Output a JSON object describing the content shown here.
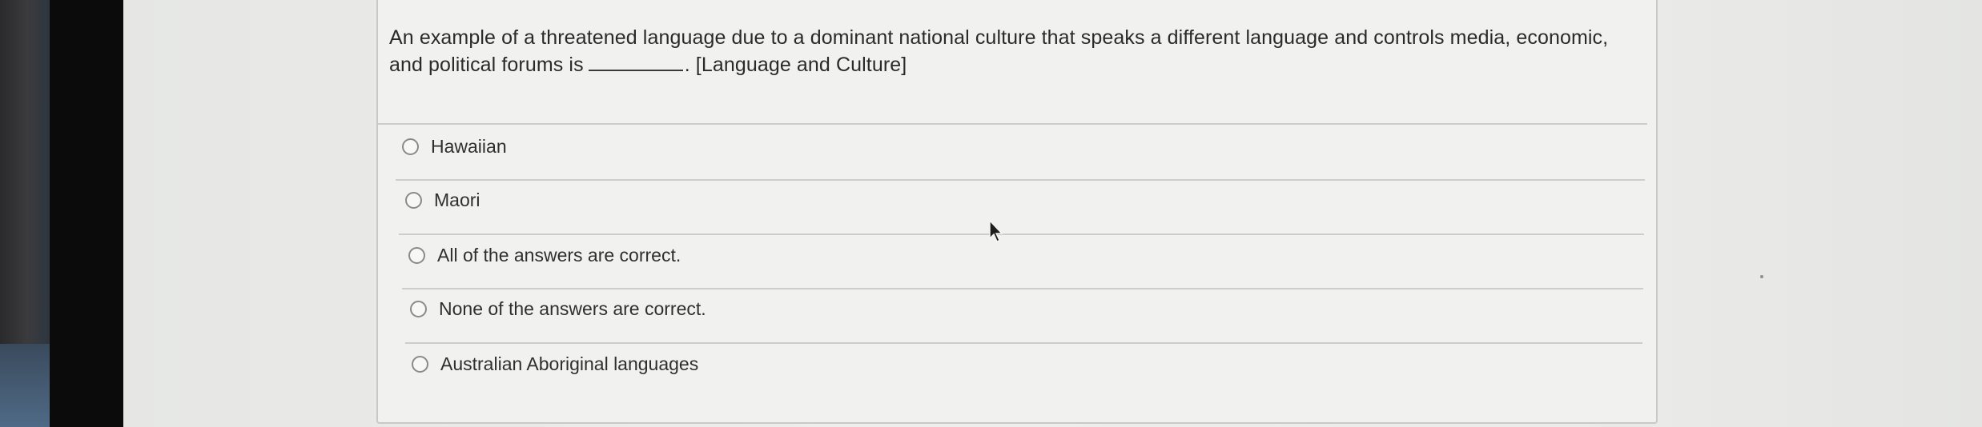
{
  "quiz": {
    "question_part1": "An example of a threatened language due to a dominant national culture that speaks a different language and controls media, economic, and political forums is",
    "question_part2": ". [Language and Culture]",
    "options": [
      {
        "label": "Hawaiian",
        "selected": false
      },
      {
        "label": "Maori",
        "selected": false
      },
      {
        "label": "All of the answers are correct.",
        "selected": false
      },
      {
        "label": "None of the answers are correct.",
        "selected": false
      },
      {
        "label": "Australian Aboriginal languages",
        "selected": false
      }
    ]
  },
  "icons": {
    "radio": "radio-button-empty",
    "cursor": "arrow-pointer-icon"
  },
  "colors": {
    "page_background": "#eeeeec",
    "text": "#2a2a2a",
    "divider": "#cdcecc",
    "bezel": "#0b0b0c"
  }
}
